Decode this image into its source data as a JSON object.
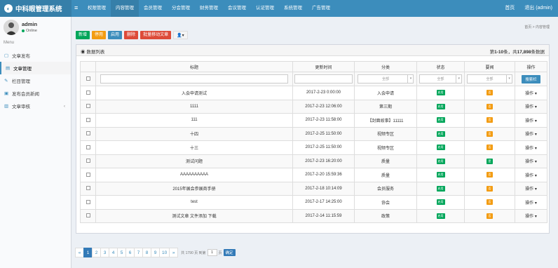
{
  "app": {
    "title": "中科眼管理系统"
  },
  "topnav": [
    "权限管理",
    "内容管理",
    "会员管理",
    "分会管理",
    "财务管理",
    "会议管理",
    "认证管理",
    "系统管理",
    "广告管理"
  ],
  "topnav_active": 1,
  "topright": {
    "home": "首页",
    "logout": "退出 (admin)"
  },
  "user": {
    "name": "admin",
    "status": "Online"
  },
  "sidebar": {
    "menu_label": "Menu",
    "items": [
      {
        "label": "文章发布",
        "icon": "book-icon"
      },
      {
        "label": "文章管理",
        "icon": "file-icon"
      },
      {
        "label": "栏目管理",
        "icon": "edit-icon"
      },
      {
        "label": "发布会员新闻",
        "icon": "news-icon"
      },
      {
        "label": "文章审核",
        "icon": "folder-icon"
      }
    ],
    "active": 1
  },
  "breadcrumb": {
    "home": "首页",
    "sep": ">",
    "current": "内容管理"
  },
  "toolbar": {
    "add": "新增",
    "disable": "停用",
    "enable": "启用",
    "delete": "删除",
    "batch_move": "批量移动文章"
  },
  "panel": {
    "title": "数据列表",
    "stats_prefix": "第",
    "range": "1-10",
    "stats_mid": "条，共",
    "total": "17,898",
    "stats_suffix": "条数据"
  },
  "table": {
    "headers": [
      "标题",
      "更新时间",
      "分类",
      "状态",
      "要闻",
      "操作"
    ],
    "filter_all": "全部",
    "search_button": "搜索栏",
    "op_label": "操作 ▾",
    "rows": [
      {
        "title": "入会申请测试",
        "time": "2017-2-23 0:00:00",
        "category": "入会申请",
        "status": "启用",
        "news": "否"
      },
      {
        "title": "1111",
        "time": "2017-2-23 12:06:00",
        "category": "第三期",
        "status": "启用",
        "news": "否"
      },
      {
        "title": "111",
        "time": "2017-2-23 11:58:00",
        "category": "【封面故事】11111",
        "status": "启用",
        "news": "否"
      },
      {
        "title": "十四",
        "time": "2017-2-25 11:50:00",
        "category": "视频专区",
        "status": "启用",
        "news": "否"
      },
      {
        "title": "十三",
        "time": "2017-2-25 11:50:00",
        "category": "视频专区",
        "status": "启用",
        "news": "否"
      },
      {
        "title": "测试问题",
        "time": "2017-2-23 16:20:00",
        "category": "质量",
        "status": "启用",
        "news": "是"
      },
      {
        "title": "AAAAAAAAAA",
        "time": "2017-2-20 15:59:36",
        "category": "质量",
        "status": "启用",
        "news": "否"
      },
      {
        "title": "2015年展会参展商手册",
        "time": "2017-2-18 10:14:09",
        "category": "会员服务",
        "status": "启用",
        "news": "否"
      },
      {
        "title": "test",
        "time": "2017-2-17 14:25:00",
        "category": "协会",
        "status": "启用",
        "news": "否"
      },
      {
        "title": "测试文章 文件添加 下载",
        "time": "2017-2-14 11:15:59",
        "category": "政策",
        "status": "启用",
        "news": "否"
      }
    ]
  },
  "pager": {
    "prev": "«",
    "next": "»",
    "pages": [
      "1",
      "2",
      "3",
      "4",
      "5",
      "6",
      "7",
      "8",
      "9",
      "10"
    ],
    "active": 0,
    "info_prefix": "共 1790 页 到第",
    "page_value": "1",
    "info_suffix": "页",
    "go": "确定"
  },
  "colors": {
    "header": "#3c8dbc",
    "brand": "#367fa9",
    "green": "#00a65a",
    "orange": "#f39c12",
    "red": "#dd4b39"
  }
}
